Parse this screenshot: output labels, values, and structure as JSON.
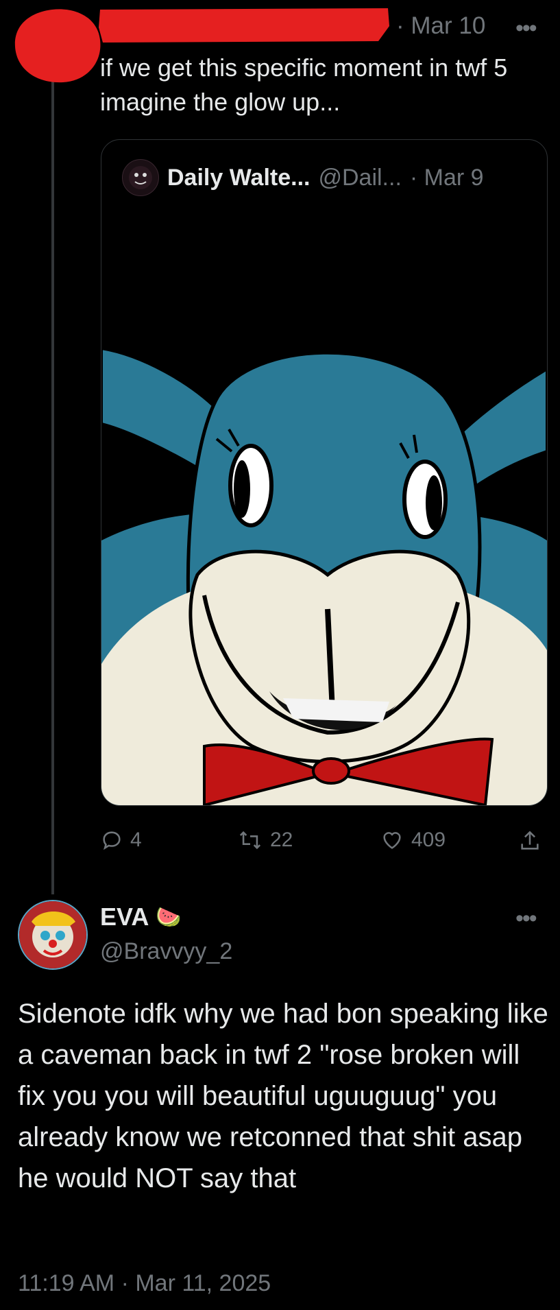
{
  "post": {
    "date": "· Mar 10",
    "more": "•••",
    "text": "if we get this specific moment in twf 5 imagine the glow up...",
    "quote": {
      "name": "Daily Walte...",
      "handle": "@Dail...",
      "date": "· Mar 9"
    },
    "actions": {
      "replies": "4",
      "reposts": "22",
      "likes": "409"
    }
  },
  "reply": {
    "name": "EVA",
    "badge": "🍉",
    "handle": "@Bravvyy_2",
    "more": "•••",
    "text": "Sidenote idfk why we had bon speaking like a caveman back in twf 2 \"rose broken will fix you you will beautiful uguuguug\" you already know we retconned that shit asap he would NOT say that",
    "timestamp": "11:19 AM · Mar 11, 2025"
  },
  "colors": {
    "background": "#000000",
    "text": "#e7e9ea",
    "muted": "#71767b",
    "redaction": "#e52020"
  }
}
